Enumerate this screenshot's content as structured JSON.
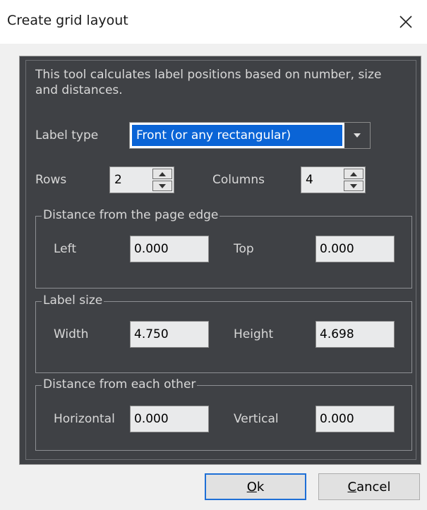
{
  "window": {
    "title": "Create grid layout"
  },
  "description": "This tool calculates label positions based on number, size and distances.",
  "label_type": {
    "label": "Label type",
    "selected": "Front (or any rectangular)"
  },
  "rows": {
    "label": "Rows",
    "value": "2"
  },
  "columns": {
    "label": "Columns",
    "value": "4"
  },
  "page_edge": {
    "legend": "Distance from the page edge",
    "left_label": "Left",
    "left_value": "0.000",
    "top_label": "Top",
    "top_value": "0.000"
  },
  "label_size": {
    "legend": "Label size",
    "width_label": "Width",
    "width_value": "4.750",
    "height_label": "Height",
    "height_value": "4.698"
  },
  "each_other": {
    "legend": "Distance from each other",
    "horizontal_label": "Horizontal",
    "horizontal_value": "0.000",
    "vertical_label": "Vertical",
    "vertical_value": "0.000"
  },
  "buttons": {
    "ok_first": "O",
    "ok_rest": "k",
    "cancel_first": "C",
    "cancel_rest": "ancel"
  }
}
